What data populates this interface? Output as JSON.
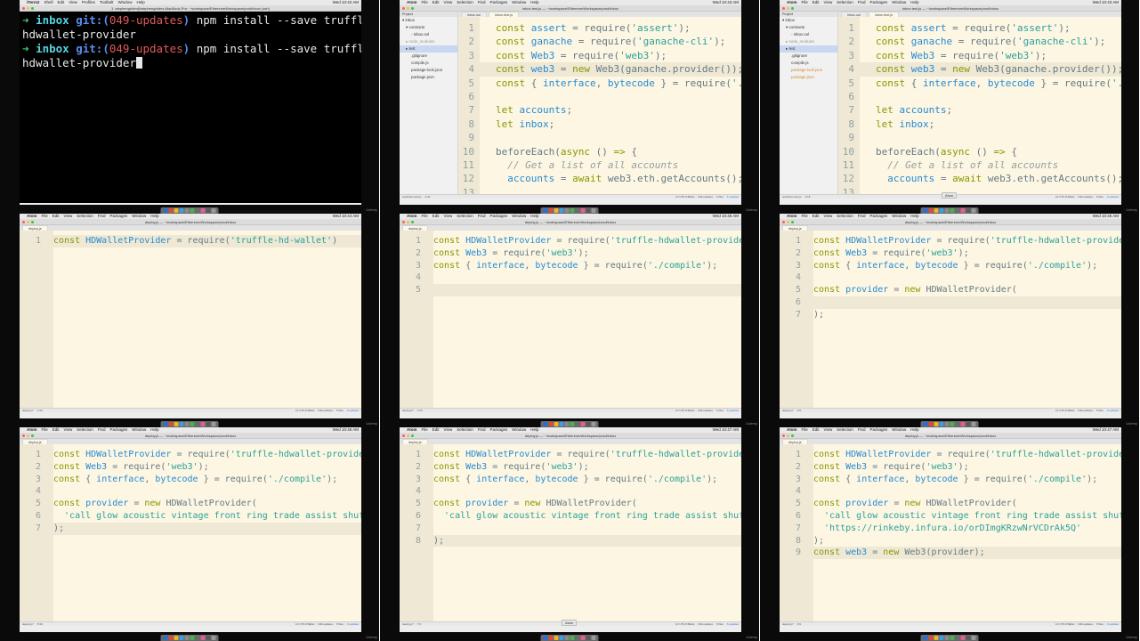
{
  "menubar": {
    "terminal": {
      "app": "iTerm2",
      "items": [
        "Shell",
        "Edit",
        "View",
        "Profiles",
        "Toolbelt",
        "Window",
        "Help"
      ],
      "clock": "Wed 10:42 AM"
    },
    "atom": {
      "app": "Atom",
      "items": [
        "File",
        "Edit",
        "View",
        "Selection",
        "Find",
        "Packages",
        "Window",
        "Help"
      ]
    }
  },
  "clocks": [
    "Wed 10:42 AM",
    "Wed 10:43 AM",
    "Wed 10:43 AM",
    "Wed 10:44 AM",
    "Wed 10:45 AM",
    "Wed 10:46 AM",
    "Wed 10:46 AM",
    "Wed 10:47 AM",
    "Wed 10:47 AM"
  ],
  "titles": {
    "terminal": "1. stephengrider@stephengriders-MacBook-Pro: ~/workspace/EthereumWorkspace/prod/inbox (zsh)",
    "inbox_test": "inbox.test.js — ~/workspace/EthereumWorkspace/prod/inbox",
    "deploy": "deploy.js — ~/workspace/EthereumWorkspace/prod/inbox"
  },
  "terminal": {
    "arrow": "➜",
    "dir": "inbox",
    "git": "git:(",
    "branch": "049-updates",
    "git_close": ")",
    "cmd1_a": " npm install --save truffle-",
    "cmd1_b": "hdwallet-provider",
    "cmd2_a": " npm install --save truffle-",
    "cmd2_b": "hdwallet-provider"
  },
  "tabs": {
    "inbox_sol": "inbox.sol",
    "inbox_test": "inbox.test.js",
    "deploy": "deploy.js"
  },
  "sidebar": {
    "header": "Project",
    "items": [
      {
        "label": "inbox",
        "prefix": "▾ ",
        "indent": 3
      },
      {
        "label": "contracts",
        "prefix": "▾ ",
        "indent": 7
      },
      {
        "label": "inbox.sol",
        "prefix": "◦ ",
        "indent": 13
      },
      {
        "label": "node_modules",
        "prefix": "▸ ",
        "indent": 7,
        "dim": true
      },
      {
        "label": "test",
        "prefix": "▸ ",
        "indent": 7,
        "selected": true
      },
      {
        "label": ".gitignore",
        "prefix": "",
        "indent": 13
      },
      {
        "label": "compile.js",
        "prefix": "",
        "indent": 13
      },
      {
        "label": "package-lock.json",
        "prefix": "",
        "indent": 13
      },
      {
        "label": "package.json",
        "prefix": "",
        "indent": 13
      }
    ]
  },
  "status": {
    "test_file": "test/inbox.test.js",
    "test_pos": "4:41",
    "test_pos2": "1:18",
    "deploy_file": "deploy.js*",
    "encoding": "LF  UTF-8  Babel",
    "branch": "049-updates",
    "files": "5 files",
    "updates": "6 updates",
    "positions": [
      "1:43",
      "1:23",
      "6:5",
      "5:39",
      "7:3",
      "9:9"
    ]
  },
  "tooltip": "Atom",
  "watermark": "Udemy",
  "code": {
    "test": [
      [
        [
          "k",
          "const "
        ],
        [
          "v",
          "assert"
        ],
        [
          "f",
          " = require("
        ],
        [
          "s",
          "'assert'"
        ],
        [
          "f",
          ");"
        ]
      ],
      [
        [
          "k",
          "const "
        ],
        [
          "v",
          "ganache"
        ],
        [
          "f",
          " = require("
        ],
        [
          "s",
          "'ganache-cli'"
        ],
        [
          "f",
          ");"
        ]
      ],
      [
        [
          "k",
          "const "
        ],
        [
          "v",
          "Web3"
        ],
        [
          "f",
          " = require("
        ],
        [
          "s",
          "'web3'"
        ],
        [
          "f",
          ");"
        ]
      ],
      [
        [
          "k",
          "const "
        ],
        [
          "v",
          "web3"
        ],
        [
          "f",
          " = "
        ],
        [
          "k",
          "new "
        ],
        [
          "f",
          "Web3(ganache.provider());"
        ]
      ],
      [
        [
          "k",
          "const "
        ],
        [
          "f",
          "{ "
        ],
        [
          "v",
          "interface"
        ],
        [
          "f",
          ", "
        ],
        [
          "v",
          "bytecode"
        ],
        [
          "f",
          " } = require("
        ],
        [
          "s",
          "'../c"
        ]
      ],
      [],
      [
        [
          "k",
          "let "
        ],
        [
          "v",
          "accounts"
        ],
        [
          "f",
          ";"
        ]
      ],
      [
        [
          "k",
          "let "
        ],
        [
          "v",
          "inbox"
        ],
        [
          "f",
          ";"
        ]
      ],
      [],
      [
        [
          "f",
          "beforeEach("
        ],
        [
          "k",
          "async "
        ],
        [
          "f",
          "() "
        ],
        [
          "k",
          "=> "
        ],
        [
          "f",
          "{"
        ]
      ],
      [
        [
          "c",
          "  // Get a list of all accounts"
        ]
      ],
      [
        [
          "f",
          "  "
        ],
        [
          "v",
          "accounts"
        ],
        [
          "f",
          " = "
        ],
        [
          "k",
          "await "
        ],
        [
          "f",
          "web3.eth.getAccounts();"
        ]
      ]
    ],
    "d1": [
      [
        [
          "k",
          "const "
        ],
        [
          "v",
          "HDWalletProvider"
        ],
        [
          "f",
          " = require("
        ],
        [
          "s",
          "'truffle-hd-wallet'"
        ],
        [
          "f",
          ")"
        ]
      ]
    ],
    "d2": [
      [
        [
          "k",
          "const "
        ],
        [
          "v",
          "HDWalletProvider"
        ],
        [
          "f",
          " = require("
        ],
        [
          "s",
          "'truffle-hdwallet-provider'"
        ],
        [
          "f",
          ");"
        ]
      ],
      [
        [
          "k",
          "const "
        ],
        [
          "v",
          "Web3"
        ],
        [
          "f",
          " = require("
        ],
        [
          "s",
          "'web3'"
        ],
        [
          "f",
          ");"
        ]
      ],
      [
        [
          "k",
          "const "
        ],
        [
          "f",
          "{ "
        ],
        [
          "v",
          "interface"
        ],
        [
          "f",
          ", "
        ],
        [
          "v",
          "bytecode"
        ],
        [
          "f",
          " } = require("
        ],
        [
          "s",
          "'./compile'"
        ],
        [
          "f",
          ");"
        ]
      ],
      [],
      []
    ],
    "d3": [
      [
        [
          "k",
          "const "
        ],
        [
          "v",
          "HDWalletProvider"
        ],
        [
          "f",
          " = require("
        ],
        [
          "s",
          "'truffle-hdwallet-provider'"
        ],
        [
          "f",
          ");"
        ]
      ],
      [
        [
          "k",
          "const "
        ],
        [
          "v",
          "Web3"
        ],
        [
          "f",
          " = require("
        ],
        [
          "s",
          "'web3'"
        ],
        [
          "f",
          ");"
        ]
      ],
      [
        [
          "k",
          "const "
        ],
        [
          "f",
          "{ "
        ],
        [
          "v",
          "interface"
        ],
        [
          "f",
          ", "
        ],
        [
          "v",
          "bytecode"
        ],
        [
          "f",
          " } = require("
        ],
        [
          "s",
          "'./compile'"
        ],
        [
          "f",
          ");"
        ]
      ],
      [],
      [
        [
          "k",
          "const "
        ],
        [
          "v",
          "provider"
        ],
        [
          "f",
          " = "
        ],
        [
          "k",
          "new "
        ],
        [
          "f",
          "HDWalletProvider("
        ]
      ],
      [],
      [
        [
          "f",
          ");"
        ]
      ]
    ],
    "d4": [
      [
        [
          "k",
          "const "
        ],
        [
          "v",
          "HDWalletProvider"
        ],
        [
          "f",
          " = require("
        ],
        [
          "s",
          "'truffle-hdwallet-provider'"
        ],
        [
          "f",
          ");"
        ]
      ],
      [
        [
          "k",
          "const "
        ],
        [
          "v",
          "Web3"
        ],
        [
          "f",
          " = require("
        ],
        [
          "s",
          "'web3'"
        ],
        [
          "f",
          ");"
        ]
      ],
      [
        [
          "k",
          "const "
        ],
        [
          "f",
          "{ "
        ],
        [
          "v",
          "interface"
        ],
        [
          "f",
          ", "
        ],
        [
          "v",
          "bytecode"
        ],
        [
          "f",
          " } = require("
        ],
        [
          "s",
          "'./compile'"
        ],
        [
          "f",
          ");"
        ]
      ],
      [],
      [
        [
          "k",
          "const "
        ],
        [
          "v",
          "provider"
        ],
        [
          "f",
          " = "
        ],
        [
          "k",
          "new "
        ],
        [
          "f",
          "HDWalletProvider("
        ]
      ],
      [
        [
          "s",
          "  'call glow acoustic vintage front ring trade assist shuffle"
        ]
      ],
      [
        [
          "f",
          ");"
        ]
      ]
    ],
    "d5": [
      [
        [
          "k",
          "const "
        ],
        [
          "v",
          "HDWalletProvider"
        ],
        [
          "f",
          " = require("
        ],
        [
          "s",
          "'truffle-hdwallet-provider'"
        ],
        [
          "f",
          ");"
        ]
      ],
      [
        [
          "k",
          "const "
        ],
        [
          "v",
          "Web3"
        ],
        [
          "f",
          " = require("
        ],
        [
          "s",
          "'web3'"
        ],
        [
          "f",
          ");"
        ]
      ],
      [
        [
          "k",
          "const "
        ],
        [
          "f",
          "{ "
        ],
        [
          "v",
          "interface"
        ],
        [
          "f",
          ", "
        ],
        [
          "v",
          "bytecode"
        ],
        [
          "f",
          " } = require("
        ],
        [
          "s",
          "'./compile'"
        ],
        [
          "f",
          ");"
        ]
      ],
      [],
      [
        [
          "k",
          "const "
        ],
        [
          "v",
          "provider"
        ],
        [
          "f",
          " = "
        ],
        [
          "k",
          "new "
        ],
        [
          "f",
          "HDWalletProvider("
        ]
      ],
      [
        [
          "s",
          "  'call glow acoustic vintage front ring trade assist shuffle"
        ]
      ],
      [],
      [
        [
          "f",
          ");"
        ]
      ]
    ],
    "d6": [
      [
        [
          "k",
          "const "
        ],
        [
          "v",
          "HDWalletProvider"
        ],
        [
          "f",
          " = require("
        ],
        [
          "s",
          "'truffle-hdwallet-provider'"
        ],
        [
          "f",
          ");"
        ]
      ],
      [
        [
          "k",
          "const "
        ],
        [
          "v",
          "Web3"
        ],
        [
          "f",
          " = require("
        ],
        [
          "s",
          "'web3'"
        ],
        [
          "f",
          ");"
        ]
      ],
      [
        [
          "k",
          "const "
        ],
        [
          "f",
          "{ "
        ],
        [
          "v",
          "interface"
        ],
        [
          "f",
          ", "
        ],
        [
          "v",
          "bytecode"
        ],
        [
          "f",
          " } = require("
        ],
        [
          "s",
          "'./compile'"
        ],
        [
          "f",
          ");"
        ]
      ],
      [],
      [
        [
          "k",
          "const "
        ],
        [
          "v",
          "provider"
        ],
        [
          "f",
          " = "
        ],
        [
          "k",
          "new "
        ],
        [
          "f",
          "HDWalletProvider("
        ]
      ],
      [
        [
          "s",
          "  'call glow acoustic vintage front ring trade assist shuffle"
        ]
      ],
      [
        [
          "s",
          "  'https://rinkeby.infura.io/orDImgKRzwNrVCDrAk5Q'"
        ]
      ],
      [
        [
          "f",
          ");"
        ]
      ],
      [
        [
          "k",
          "const "
        ],
        [
          "v",
          "web3"
        ],
        [
          "f",
          " = "
        ],
        [
          "k",
          "new "
        ],
        [
          "f",
          "Web3(provider);"
        ]
      ]
    ]
  },
  "frames": [
    {
      "kind": "terminal",
      "clock": 0
    },
    {
      "kind": "test",
      "clock": 1,
      "title": "inbox_test",
      "start": 1,
      "current": 4
    },
    {
      "kind": "test",
      "clock": 2,
      "title": "inbox_test",
      "start": 1,
      "current": 4
    },
    {
      "kind": "deploy",
      "clock": 3,
      "block": "d1",
      "current": 1,
      "pos": 0
    },
    {
      "kind": "deploy",
      "clock": 4,
      "block": "d2",
      "current": 5,
      "pos": 1
    },
    {
      "kind": "deploy",
      "clock": 5,
      "block": "d3",
      "current": 6,
      "pos": 2
    },
    {
      "kind": "deploy",
      "clock": 6,
      "block": "d4",
      "current": 7,
      "pos": 3
    },
    {
      "kind": "deploy",
      "clock": 7,
      "block": "d5",
      "current": 8,
      "pos": 4
    },
    {
      "kind": "deploy",
      "clock": 8,
      "block": "d6",
      "current": 9,
      "pos": 5
    }
  ]
}
